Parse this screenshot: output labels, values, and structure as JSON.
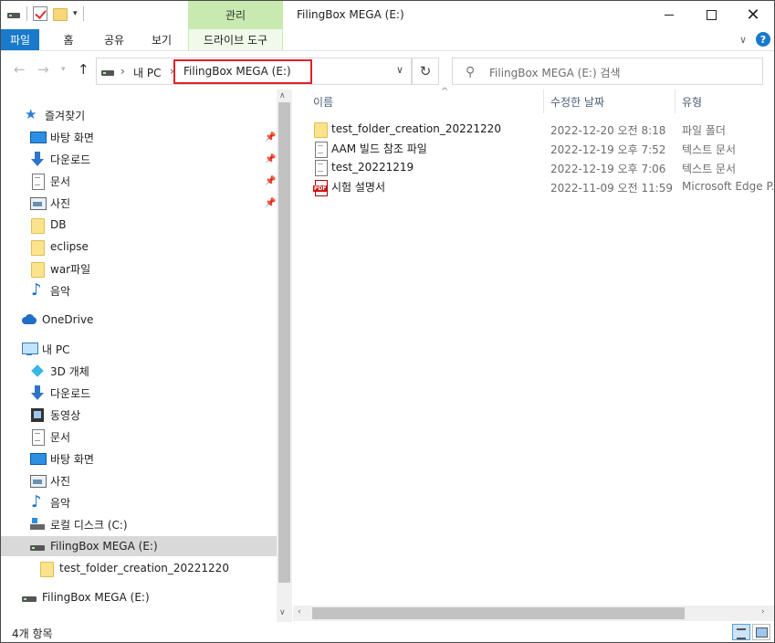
{
  "window": {
    "title": "FilingBox MEGA (E:)",
    "context_tab_group": "관리"
  },
  "ribbon": {
    "tabs": [
      "파일",
      "홈",
      "공유",
      "보기"
    ],
    "context_tab": "드라이브 도구"
  },
  "address": {
    "crumbs": [
      "내 PC",
      "FilingBox MEGA (E:)"
    ],
    "search_placeholder": "FilingBox MEGA (E:) 검색"
  },
  "nav": {
    "quick_access": "즐겨찾기",
    "quick_items": [
      "바탕 화면",
      "다운로드",
      "문서",
      "사진",
      "DB",
      "eclipse",
      "war파일",
      "음악"
    ],
    "onedrive": "OneDrive",
    "this_pc": "내 PC",
    "pc_items": [
      "3D 개체",
      "다운로드",
      "동영상",
      "문서",
      "바탕 화면",
      "사진",
      "음악",
      "로컬 디스크 (C:)",
      "FilingBox MEGA (E:)"
    ],
    "sub_item": "test_folder_creation_20221220",
    "bottom_drive": "FilingBox MEGA (E:)"
  },
  "files": {
    "columns": {
      "name": "이름",
      "modified": "수정한 날짜",
      "type": "유형"
    },
    "rows": [
      {
        "name": "test_folder_creation_20221220",
        "modified": "2022-12-20 오전 8:18",
        "type": "파일 폴더",
        "icon": "folder-icon"
      },
      {
        "name": "AAM 빌드 참조 파일",
        "modified": "2022-12-19 오후 7:52",
        "type": "텍스트 문서",
        "icon": "text-file-icon"
      },
      {
        "name": "test_20221219",
        "modified": "2022-12-19 오후 7:06",
        "type": "텍스트 문서",
        "icon": "text-file-icon"
      },
      {
        "name": "시험 설명서",
        "modified": "2022-11-09 오전 11:59",
        "type": "Microsoft Edge P...",
        "icon": "pdf-icon"
      }
    ]
  },
  "status": {
    "item_count": "4개 항목"
  },
  "colors": {
    "accent": "#1979ca",
    "context_tab": "#c8eab0",
    "highlight_box": "#e0202a",
    "selection": "#d9d9d9"
  }
}
